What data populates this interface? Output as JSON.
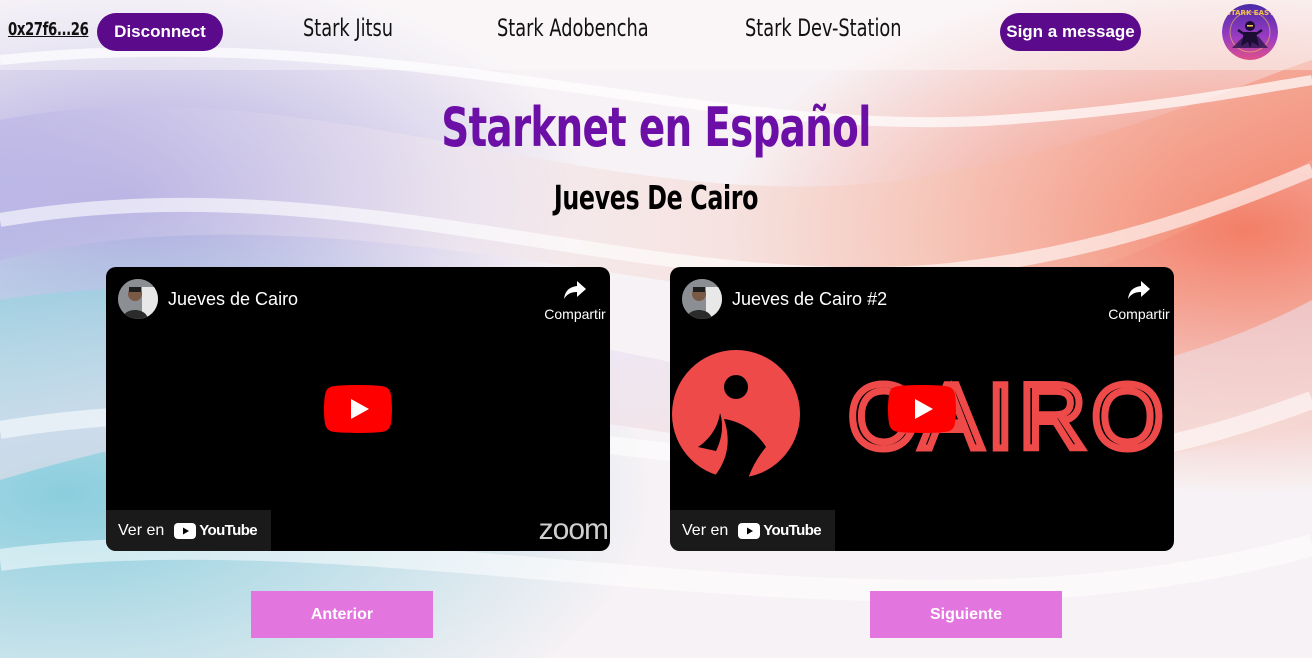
{
  "header": {
    "wallet_address": "0x27f6...26",
    "disconnect_label": "Disconnect",
    "nav": [
      "Stark Jitsu",
      "Stark Adobencha",
      "Stark Dev-Station"
    ],
    "sign_label": "Sign a message",
    "logo_text": "STARK EASY"
  },
  "main": {
    "title": "Starknet en Español",
    "subtitle": "Jueves De Cairo"
  },
  "videos": [
    {
      "title": "Jueves de Cairo",
      "share_label": "Compartir",
      "watch_on": "Ver en",
      "youtube_label": "YouTube",
      "watermark": "zoom"
    },
    {
      "title": "Jueves de Cairo #2",
      "share_label": "Compartir",
      "watch_on": "Ver en",
      "youtube_label": "YouTube",
      "thumbnail_text": "CAIRO"
    }
  ],
  "pagination": {
    "prev_label": "Anterior",
    "next_label": "Siguiente"
  },
  "colors": {
    "accent_purple": "#5a0a8a",
    "title_purple": "#6b0fa6",
    "button_pink": "#e276de",
    "youtube_red": "#ff0000",
    "cairo_red": "#ef4a4a"
  }
}
